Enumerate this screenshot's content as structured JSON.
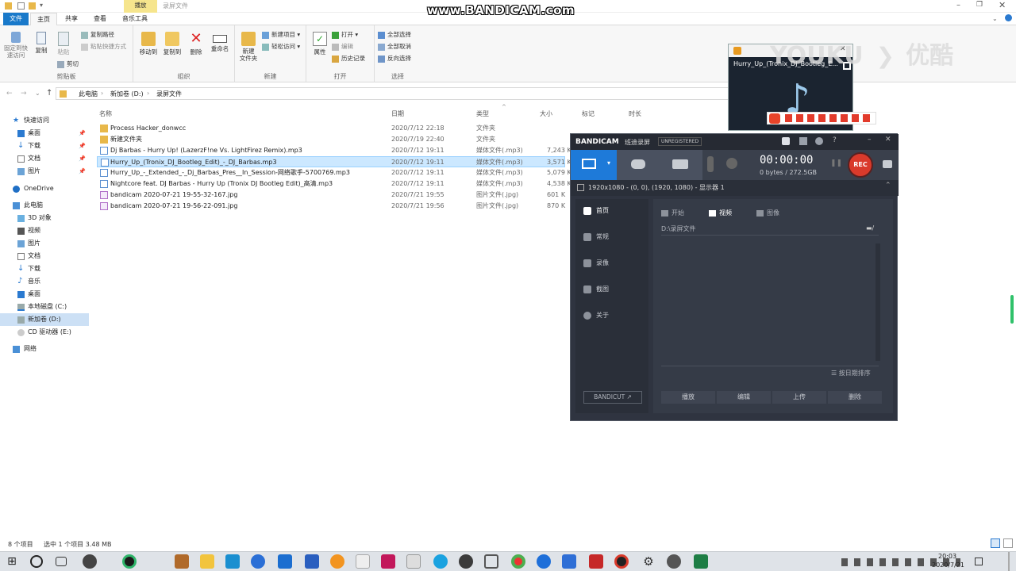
{
  "window": {
    "title_tab": "播放",
    "title": "录屏文件",
    "tabs": [
      "文件",
      "主页",
      "共享",
      "查看",
      "音乐工具"
    ]
  },
  "ribbon": {
    "clipboard": {
      "label": "剪贴板",
      "pin_quick_access": "固定到快速访问",
      "copy": "复制",
      "paste": "粘贴",
      "copy_path": "复制路径",
      "paste_shortcut": "粘贴快捷方式",
      "cut": "剪切"
    },
    "organize": {
      "label": "组织",
      "move_to": "移动到",
      "copy_to": "复制到",
      "delete": "删除",
      "rename": "重命名"
    },
    "new": {
      "label": "新建",
      "new_folder": "新建\n文件夹",
      "new_item": "新建项目",
      "easy_access": "轻松访问"
    },
    "open": {
      "label": "打开",
      "properties": "属性",
      "open": "打开",
      "edit": "编辑",
      "history": "历史记录"
    },
    "select": {
      "label": "选择",
      "select_all": "全部选择",
      "select_none": "全部取消",
      "invert": "反向选择"
    }
  },
  "address": {
    "crumbs": [
      "此电脑",
      "新加卷 (D:)",
      "录屏文件"
    ]
  },
  "nav": {
    "items": [
      {
        "label": "快速访问",
        "pinned": false
      },
      {
        "label": "桌面",
        "pinned": true
      },
      {
        "label": "下载",
        "pinned": true
      },
      {
        "label": "文档",
        "pinned": true
      },
      {
        "label": "图片",
        "pinned": true
      },
      {
        "label": "OneDrive",
        "pinned": false
      },
      {
        "label": "此电脑",
        "pinned": false
      },
      {
        "label": "3D 对象",
        "pinned": false
      },
      {
        "label": "视频",
        "pinned": false
      },
      {
        "label": "图片",
        "pinned": false
      },
      {
        "label": "文档",
        "pinned": false
      },
      {
        "label": "下载",
        "pinned": false
      },
      {
        "label": "音乐",
        "pinned": false
      },
      {
        "label": "桌面",
        "pinned": false
      },
      {
        "label": "本地磁盘 (C:)",
        "pinned": false
      },
      {
        "label": "新加卷 (D:)",
        "pinned": false
      },
      {
        "label": "CD 驱动器 (E:)",
        "pinned": false
      },
      {
        "label": "网络",
        "pinned": false
      }
    ]
  },
  "files": {
    "headers": {
      "name": "名称",
      "date": "日期",
      "type": "类型",
      "size": "大小",
      "tags": "标记",
      "duration": "时长"
    },
    "rows": [
      {
        "name": "Process Hacker_donwcc",
        "date": "2020/7/12 22:18",
        "type": "文件夹",
        "size": "",
        "kind": "folder"
      },
      {
        "name": "新建文件夹",
        "date": "2020/7/19 22:40",
        "type": "文件夹",
        "size": "",
        "kind": "folder"
      },
      {
        "name": "Dj Barbas - Hurry Up! (LazerzF!ne Vs. LightFirez Remix).mp3",
        "date": "2020/7/12 19:11",
        "type": "媒体文件(.mp3)",
        "size": "7,243 K",
        "kind": "mp3"
      },
      {
        "name": "Hurry_Up_(Tronix_DJ_Bootleg_Edit)_-_DJ_Barbas.mp3",
        "date": "2020/7/12 19:11",
        "type": "媒体文件(.mp3)",
        "size": "3,571 K",
        "kind": "mp3"
      },
      {
        "name": "Hurry_Up_-_Extended_-_Dj_Barbas_Pres__In_Session-网络歌手-5700769.mp3",
        "date": "2020/7/12 19:11",
        "type": "媒体文件(.mp3)",
        "size": "5,079 K",
        "kind": "mp3"
      },
      {
        "name": "Nightcore feat. DJ Barbas - Hurry Up (Tronix DJ Bootleg Edit)_高清.mp3",
        "date": "2020/7/12 19:11",
        "type": "媒体文件(.mp3)",
        "size": "4,538 K",
        "kind": "mp3"
      },
      {
        "name": "bandicam 2020-07-21 19-55-32-167.jpg",
        "date": "2020/7/21 19:55",
        "type": "图片文件(.jpg)",
        "size": "601 K",
        "kind": "jpg"
      },
      {
        "name": "bandicam 2020-07-21 19-56-22-091.jpg",
        "date": "2020/7/21 19:56",
        "type": "图片文件(.jpg)",
        "size": "870 K",
        "kind": "jpg"
      }
    ],
    "selected_index": 3
  },
  "status": {
    "count": "8 个项目",
    "selection": "选中 1 个项目  3.48 MB"
  },
  "watermarks": {
    "bandicam": "www.BANDICAM.com",
    "youku": "YOUKU",
    "youku_cn": "优酷"
  },
  "youku_player": {
    "title": "Hurry_Up_(Tronix_DJ_Bootleg_E..."
  },
  "bandicam": {
    "brand": "BANDICAM",
    "subtitle": "班迪录屏",
    "license": "UNREGISTERED",
    "timer": "00:00:00",
    "storage": "0 bytes / 272.5GB",
    "rec_label": "REC",
    "resolution": "1920x1080 - (0, 0), (1920, 1080) - 显示器 1",
    "sidebar": [
      "首页",
      "常规",
      "录像",
      "截图",
      "关于"
    ],
    "tabs": [
      "开始",
      "视频",
      "图像"
    ],
    "path": "D:\\录屏文件",
    "sort_label": "按日期排序",
    "buttons": [
      "播放",
      "编辑",
      "上传",
      "删除"
    ],
    "bandicut": "BANDICUT ↗",
    "accent": "#1e7ad9",
    "rec_color": "#d93a2b"
  },
  "taskbar": {
    "time": "20:03",
    "date": "2020/7/21"
  }
}
